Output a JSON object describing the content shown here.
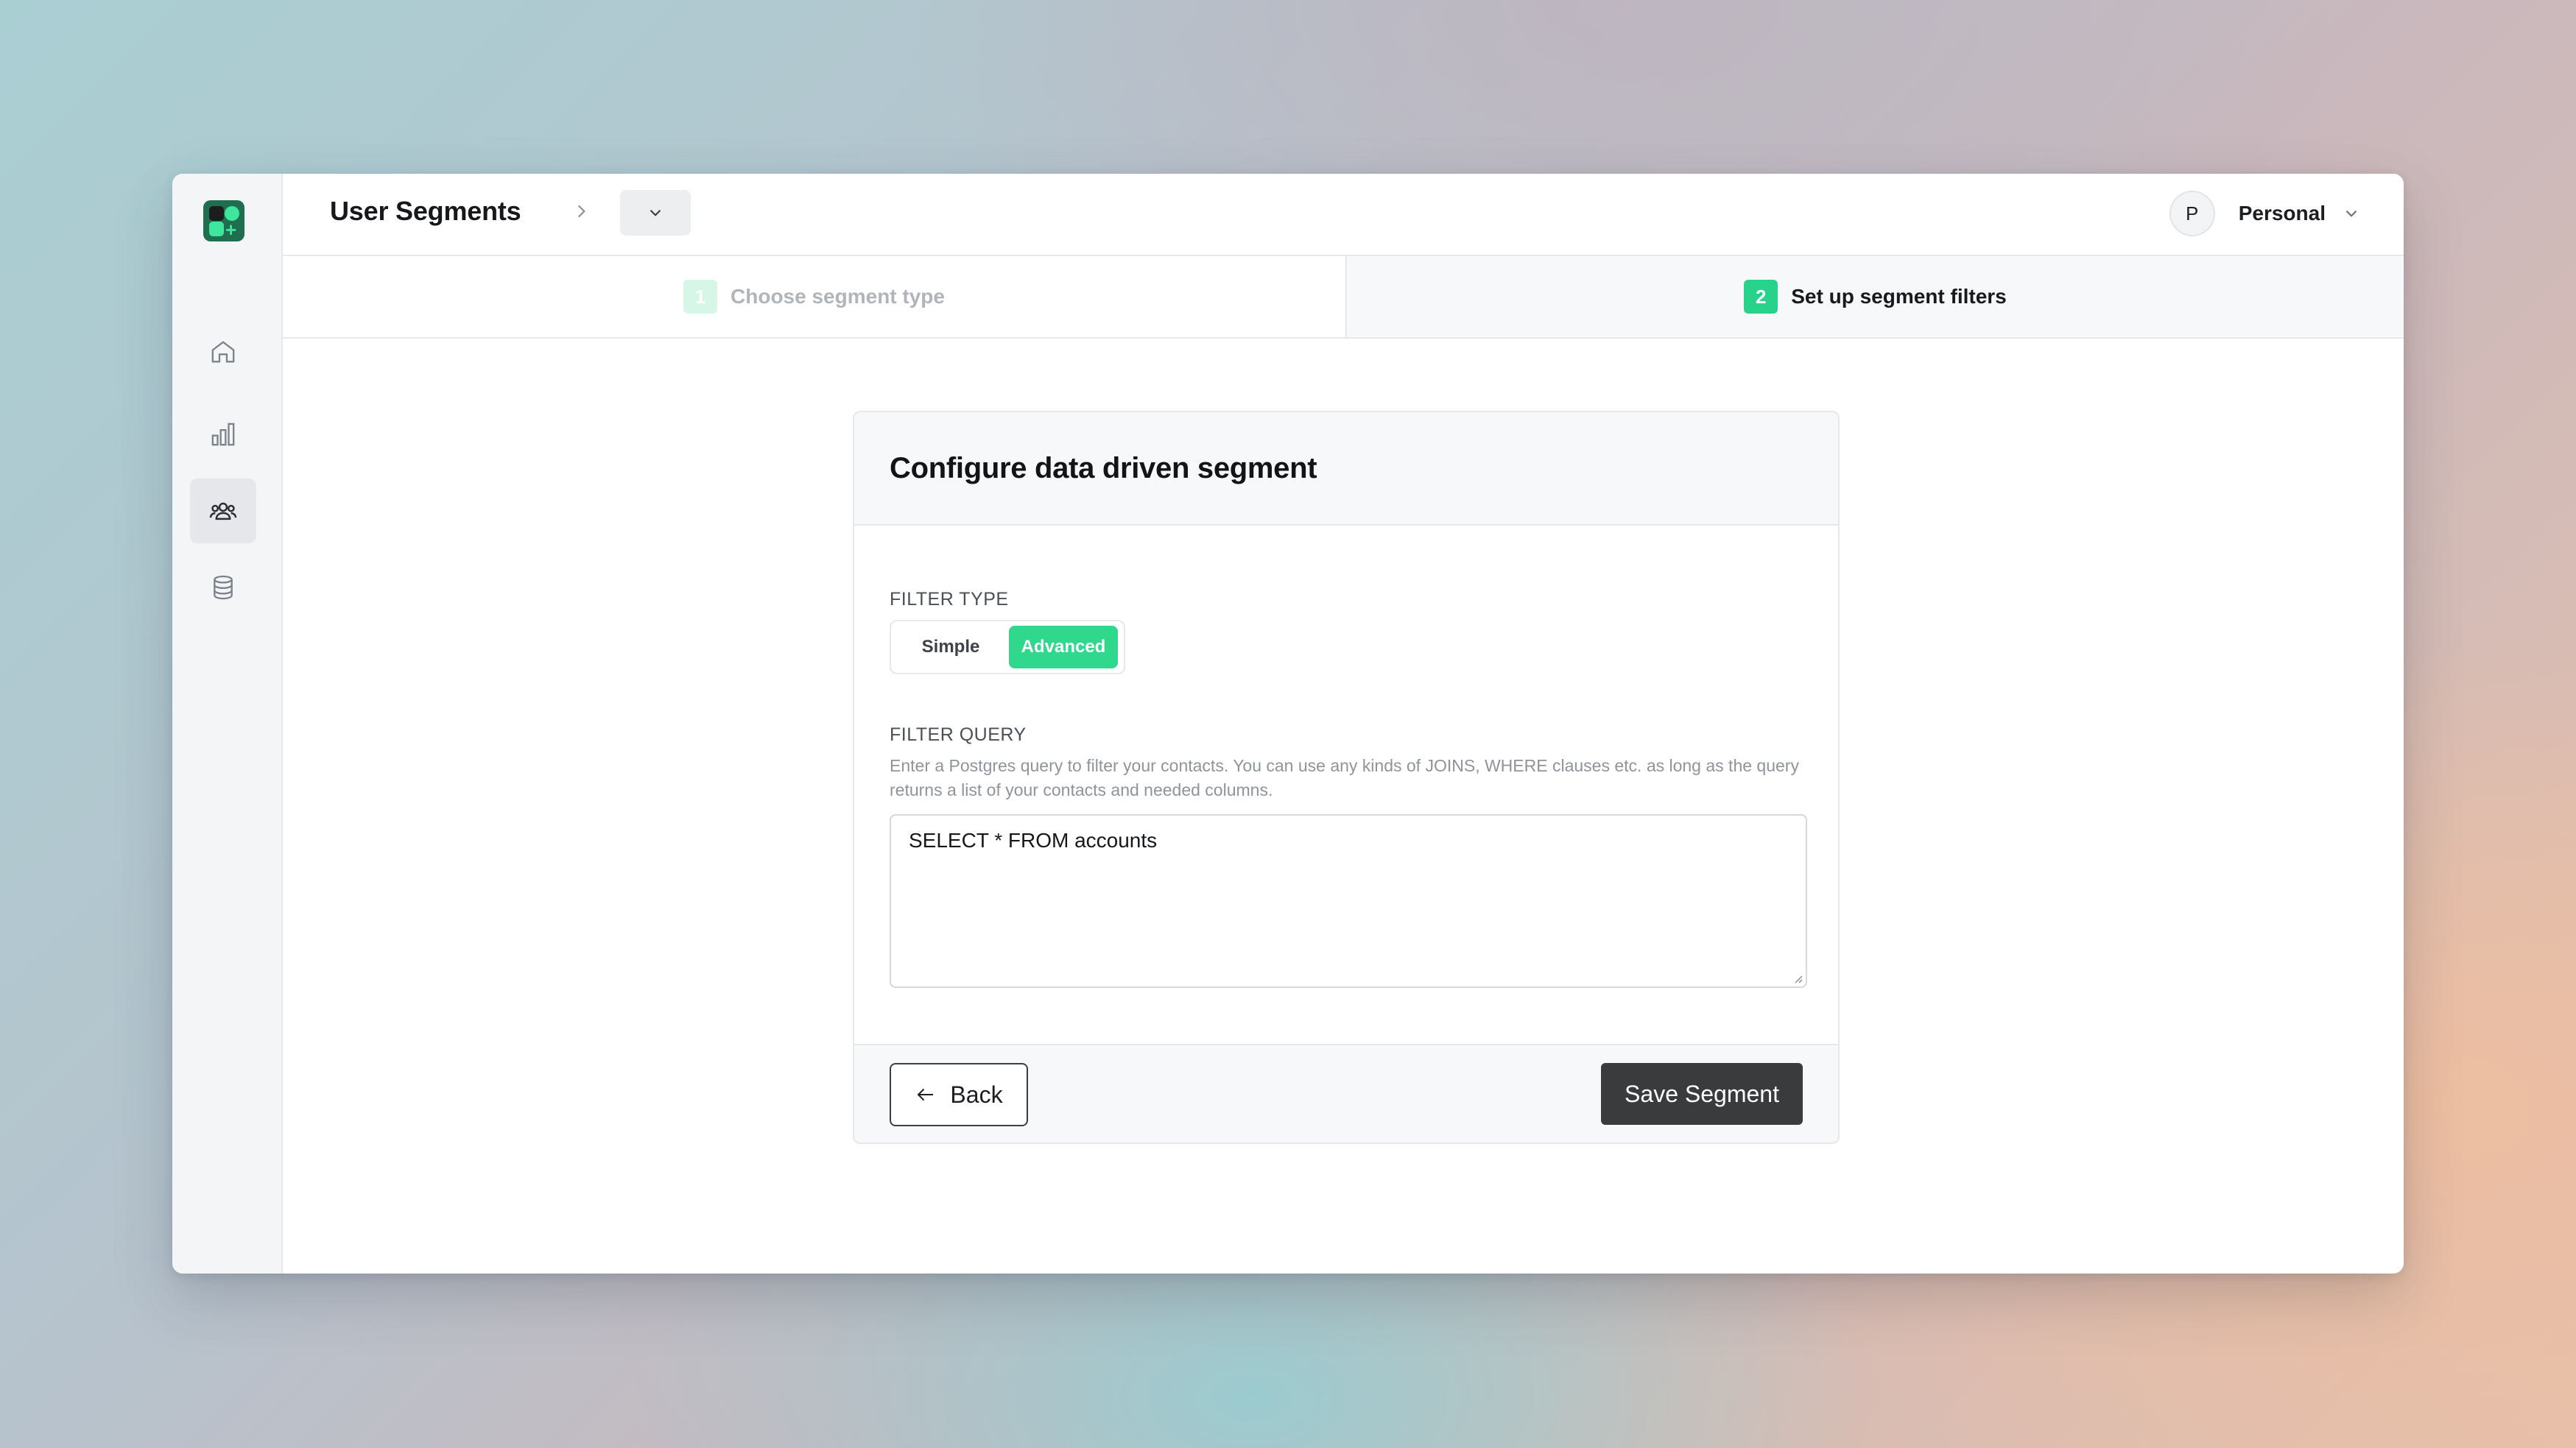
{
  "header": {
    "title": "User Segments",
    "account_initial": "P",
    "account_name": "Personal"
  },
  "sidebar": {
    "items": [
      {
        "icon": "home-icon",
        "active": false
      },
      {
        "icon": "bar-chart-icon",
        "active": false
      },
      {
        "icon": "users-icon",
        "active": true
      },
      {
        "icon": "database-icon",
        "active": false
      }
    ]
  },
  "steps": [
    {
      "number": "1",
      "label": "Choose segment type",
      "state": "completed"
    },
    {
      "number": "2",
      "label": "Set up segment filters",
      "state": "current"
    }
  ],
  "card": {
    "title": "Configure data driven segment",
    "filter_type": {
      "label": "FILTER TYPE",
      "options": [
        "Simple",
        "Advanced"
      ],
      "selected": "Advanced"
    },
    "filter_query": {
      "label": "FILTER QUERY",
      "help": "Enter a Postgres query to filter your contacts. You can use any kinds of JOINS, WHERE clauses etc. as long as the query returns a list of your contacts and needed columns.",
      "value": "SELECT * FROM accounts"
    },
    "back_label": "Back",
    "save_label": "Save Segment"
  },
  "colors": {
    "accent": "#2fd88d",
    "primary_button": "#3a3b3d"
  }
}
